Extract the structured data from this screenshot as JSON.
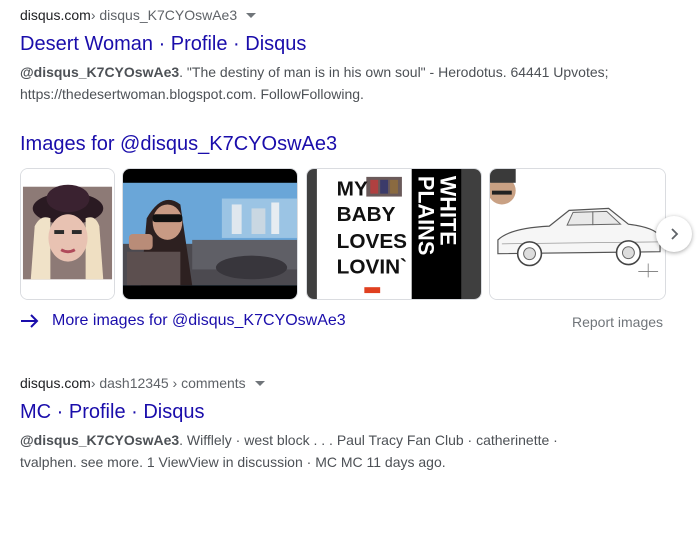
{
  "result1": {
    "site": "disqus.com",
    "path": " › disqus_K7CYOswAe3",
    "title": "Desert Woman · Profile · Disqus",
    "snippet_bold": "@disqus_K7CYOswAe3",
    "snippet_line1": ". \"The destiny of man is in his own soul\" - Herodotus. 64441 Upvotes;",
    "snippet_line2": "https://thedesertwoman.blogspot.com. FollowFollowing."
  },
  "images": {
    "heading": "Images for @disqus_K7CYOswAe3",
    "thumb3_text": {
      "left_lines": [
        "MY",
        "BABY",
        "LOVES",
        "LOVIN`"
      ],
      "right_lines": [
        "WHITE",
        "PLAINS"
      ]
    },
    "more_label": "More images for @disqus_K7CYOswAe3",
    "report_label": "Report images"
  },
  "result2": {
    "site": "disqus.com",
    "path": " › dash12345 › comments",
    "title": "MC · Profile · Disqus",
    "snippet_bold": "@disqus_K7CYOswAe3",
    "snippet_line1": ". Wifflely · west block . . . Paul Tracy Fan Club · catherinette ·",
    "snippet_line2": "tvalphen. see more. 1 ViewView in discussion · MC MC 11 days ago."
  },
  "colors": {
    "link": "#1a0dab",
    "snippet": "#4d5156",
    "secondary": "#70757a",
    "border": "#dadce0"
  }
}
